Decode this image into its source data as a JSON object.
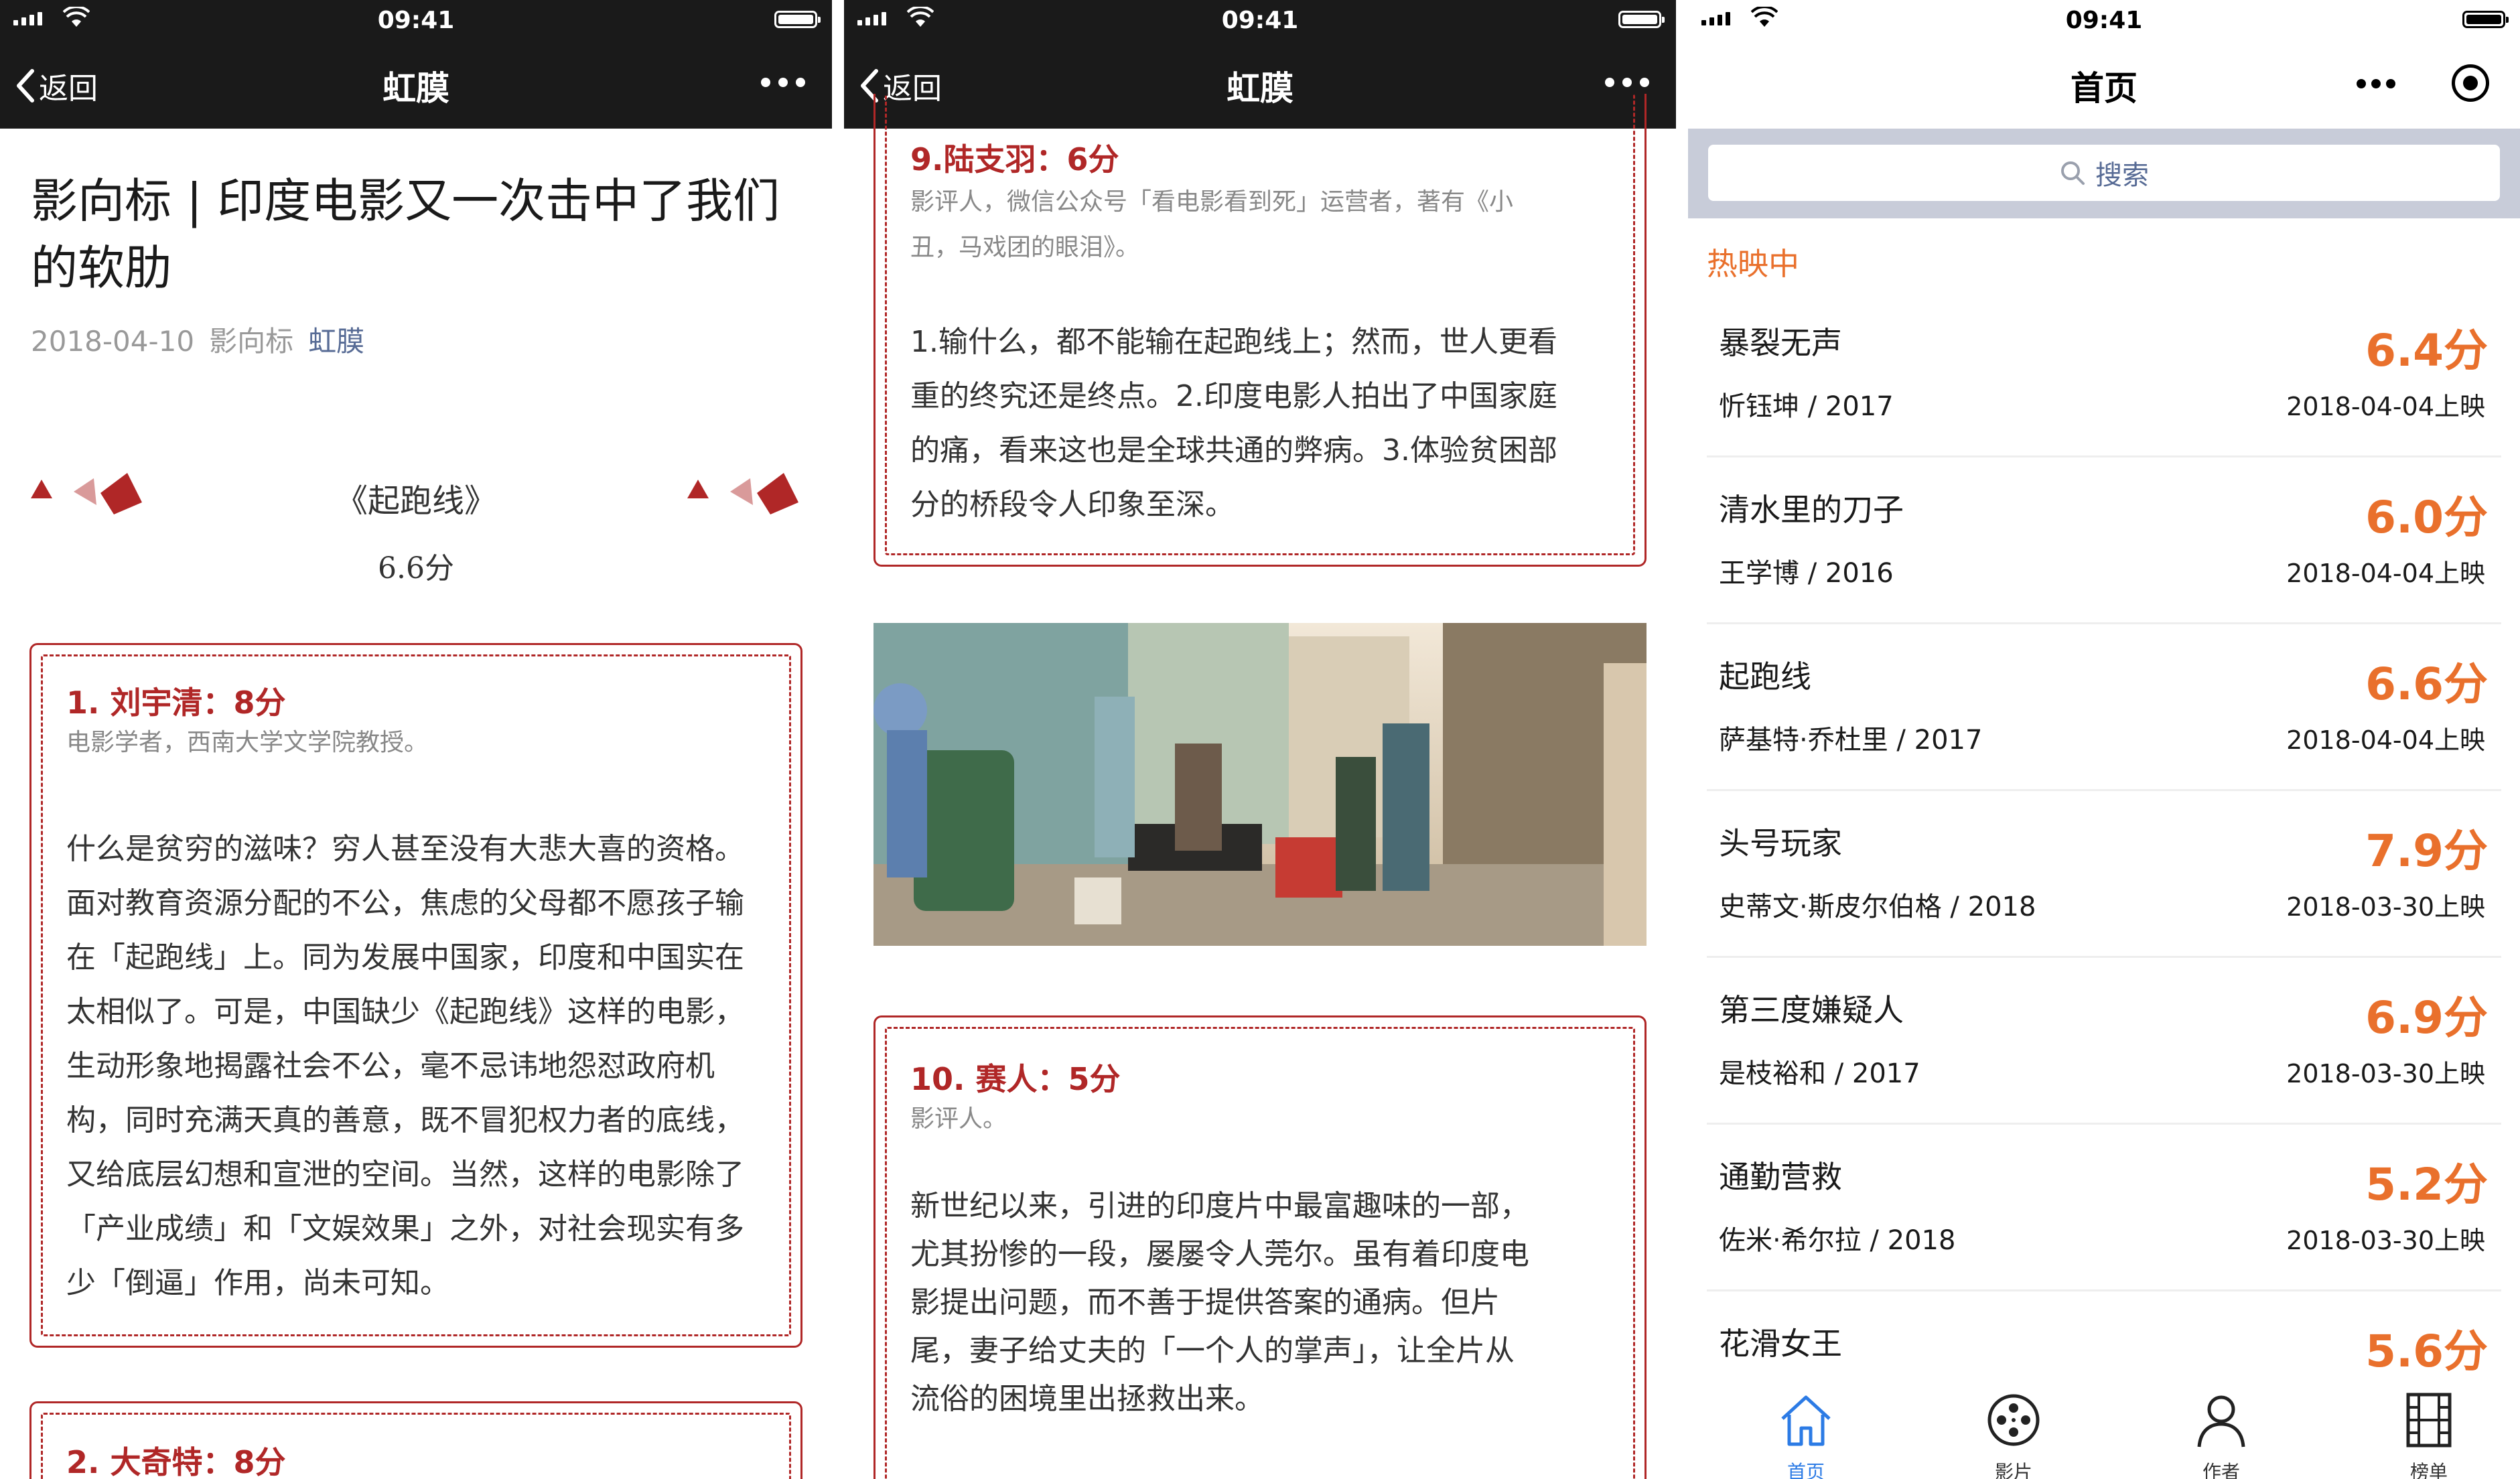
{
  "status": {
    "time": "09:41"
  },
  "screen1": {
    "nav": {
      "back": "返回",
      "title": "虹膜"
    },
    "article": {
      "title": "影向标 | 印度电影又一次击中了我们的软肋",
      "date": "2018-04-10",
      "column": "影向标",
      "author": "虹膜"
    },
    "movie": {
      "name": "《起跑线》",
      "score": "6.6分"
    },
    "reviews": [
      {
        "name": "1. 刘宇清：8分",
        "desc": "电影学者，西南大学文学院教授。",
        "lines": [
          "什么是贫穷的滋味？穷人甚至没有大悲大喜的资格。",
          "面对教育资源分配的不公，焦虑的父母都不愿孩子输",
          "在「起跑线」上。同为发展中国家，印度和中国实在",
          "太相似了。可是，中国缺少《起跑线》这样的电影，",
          "生动形象地揭露社会不公，毫不忌讳地怨怼政府机",
          "构，同时充满天真的善意，既不冒犯权力者的底线，",
          "又给底层幻想和宣泄的空间。当然，这样的电影除了",
          "「产业成绩」和「文娱效果」之外，对社会现实有多",
          "少「倒逼」作用，尚未可知。"
        ]
      },
      {
        "name": "2. 大奇特：8分"
      }
    ]
  },
  "screen2": {
    "nav": {
      "back": "返回",
      "title": "虹膜"
    },
    "review9": {
      "name": "9.陆支羽：6分",
      "desc": [
        "影评人，微信公众号「看电影看到死」运营者，著有《小",
        "丑，马戏团的眼泪》。"
      ],
      "lines": [
        "1.输什么，都不能输在起跑线上；然而，世人更看",
        "重的终究还是终点。2.印度电影人拍出了中国家庭",
        "的痛，看来这也是全球共通的弊病。3.体验贫困部",
        "分的桥段令人印象至深。"
      ]
    },
    "review10": {
      "name": "10. 赛人：5分",
      "desc": [
        "影评人。"
      ],
      "lines": [
        "新世纪以来，引进的印度片中最富趣味的一部，",
        "尤其扮惨的一段，屡屡令人莞尔。虽有着印度电",
        "影提出问题，而不善于提供答案的通病。但片",
        "尾，妻子给丈夫的「一个人的掌声」，让全片从",
        "流俗的困境里出拯救出来。"
      ]
    }
  },
  "screen3": {
    "nav": {
      "title": "首页"
    },
    "search": {
      "placeholder": "搜索"
    },
    "section": "热映中",
    "movies": [
      {
        "title": "暴裂无声",
        "sub": "忻钰坤 / 2017",
        "score": "6.4分",
        "date": "2018-04-04上映"
      },
      {
        "title": "清水里的刀子",
        "sub": "王学博 / 2016",
        "score": "6.0分",
        "date": "2018-04-04上映"
      },
      {
        "title": "起跑线",
        "sub": "萨基特·乔杜里 / 2017",
        "score": "6.6分",
        "date": "2018-04-04上映"
      },
      {
        "title": "头号玩家",
        "sub": "史蒂文·斯皮尔伯格 / 2018",
        "score": "7.9分",
        "date": "2018-03-30上映"
      },
      {
        "title": "第三度嫌疑人",
        "sub": "是枝裕和 / 2017",
        "score": "6.9分",
        "date": "2018-03-30上映"
      },
      {
        "title": "通勤营救",
        "sub": "佐米·希尔拉 / 2018",
        "score": "5.2分",
        "date": "2018-03-30上映"
      },
      {
        "title": "花滑女王",
        "score": "5.6分"
      }
    ],
    "tabs": [
      {
        "label": "首页",
        "icon": "home-icon"
      },
      {
        "label": "影片",
        "icon": "film-reel-icon"
      },
      {
        "label": "作者",
        "icon": "user-icon"
      },
      {
        "label": "榜单",
        "icon": "film-strip-icon"
      }
    ]
  },
  "colors": {
    "accent_red": "#b02727",
    "accent_orange": "#e9702c",
    "tab_active": "#2c7be5",
    "link_blue": "#576b95"
  }
}
